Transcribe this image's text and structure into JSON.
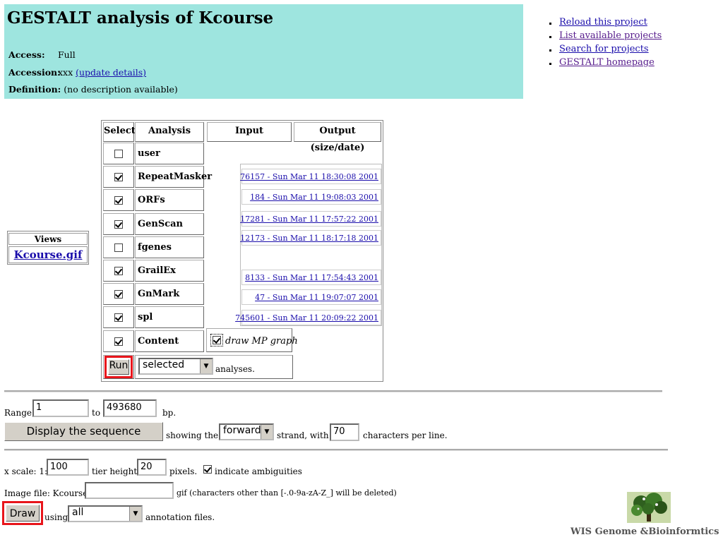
{
  "header": {
    "title": "GESTALT analysis of Kcourse",
    "access_label": "Access:",
    "access_value": "Full",
    "accession_label": "Accession:",
    "accession_value": "xxx",
    "accession_link": "(update details)",
    "definition_label": "Definition:",
    "definition_value": "(no description available)"
  },
  "nav": [
    {
      "label": "Reload this project"
    },
    {
      "label": "List available projects"
    },
    {
      "label": "Search for projects"
    },
    {
      "label": "GESTALT homepage"
    }
  ],
  "views": {
    "header": "Views",
    "link": "Kcourse.gif"
  },
  "analysis_table": {
    "headers": [
      "Select",
      "Analysis",
      "Input",
      "Output (size/date)"
    ],
    "rows": [
      {
        "name": "user",
        "checked": false,
        "output": ""
      },
      {
        "name": "RepeatMasker",
        "checked": true,
        "output": "76157 - Sun Mar 11 18:30:08 2001"
      },
      {
        "name": "ORFs",
        "checked": true,
        "output": "184 - Sun Mar 11 19:08:03 2001"
      },
      {
        "name": "GenScan",
        "checked": true,
        "output": "17281 - Sun Mar 11 17:57:22 2001"
      },
      {
        "name": "fgenes",
        "checked": false,
        "output": "12173 - Sun Mar 11 18:17:18 2001"
      },
      {
        "name": "GrailEx",
        "checked": true,
        "output": "8133 - Sun Mar 11 17:54:43 2001"
      },
      {
        "name": "GnMark",
        "checked": true,
        "output": "47 - Sun Mar 11 19:07:07 2001"
      },
      {
        "name": "spl",
        "checked": true,
        "output": "745601 - Sun Mar 11 20:09:22 2001"
      },
      {
        "name": "Content",
        "checked": true,
        "output": ""
      }
    ],
    "draw_mp_label": "draw MP graph",
    "draw_mp_checked": true,
    "run_label": "Run",
    "run_select": "selected",
    "run_suffix": "analyses."
  },
  "range": {
    "label": "Range:",
    "from": "1",
    "to_label": "to",
    "to": "493680",
    "unit": "bp."
  },
  "sequence": {
    "button": "Display the sequence",
    "showing": "showing the",
    "strand": "forward",
    "strand_suffix": "strand, with",
    "chars": "70",
    "chars_suffix": "characters per line."
  },
  "image": {
    "xscale_label": "x scale: 1:",
    "xscale": "100",
    "tier_label": "tier height:",
    "tier": "20",
    "pixels": "pixels.",
    "ambig_label": "indicate ambiguities",
    "ambig_checked": true,
    "file_label": "Image file: Kcourse.",
    "file_value": "",
    "file_suffix": "gif (characters other than [-.0-9a-zA-Z_] will be deleted)",
    "draw_label": "Draw",
    "using": "using",
    "annot_select": "all",
    "annot_suffix": "annotation files."
  },
  "footer": "WIS Genome &Bioinformtics"
}
